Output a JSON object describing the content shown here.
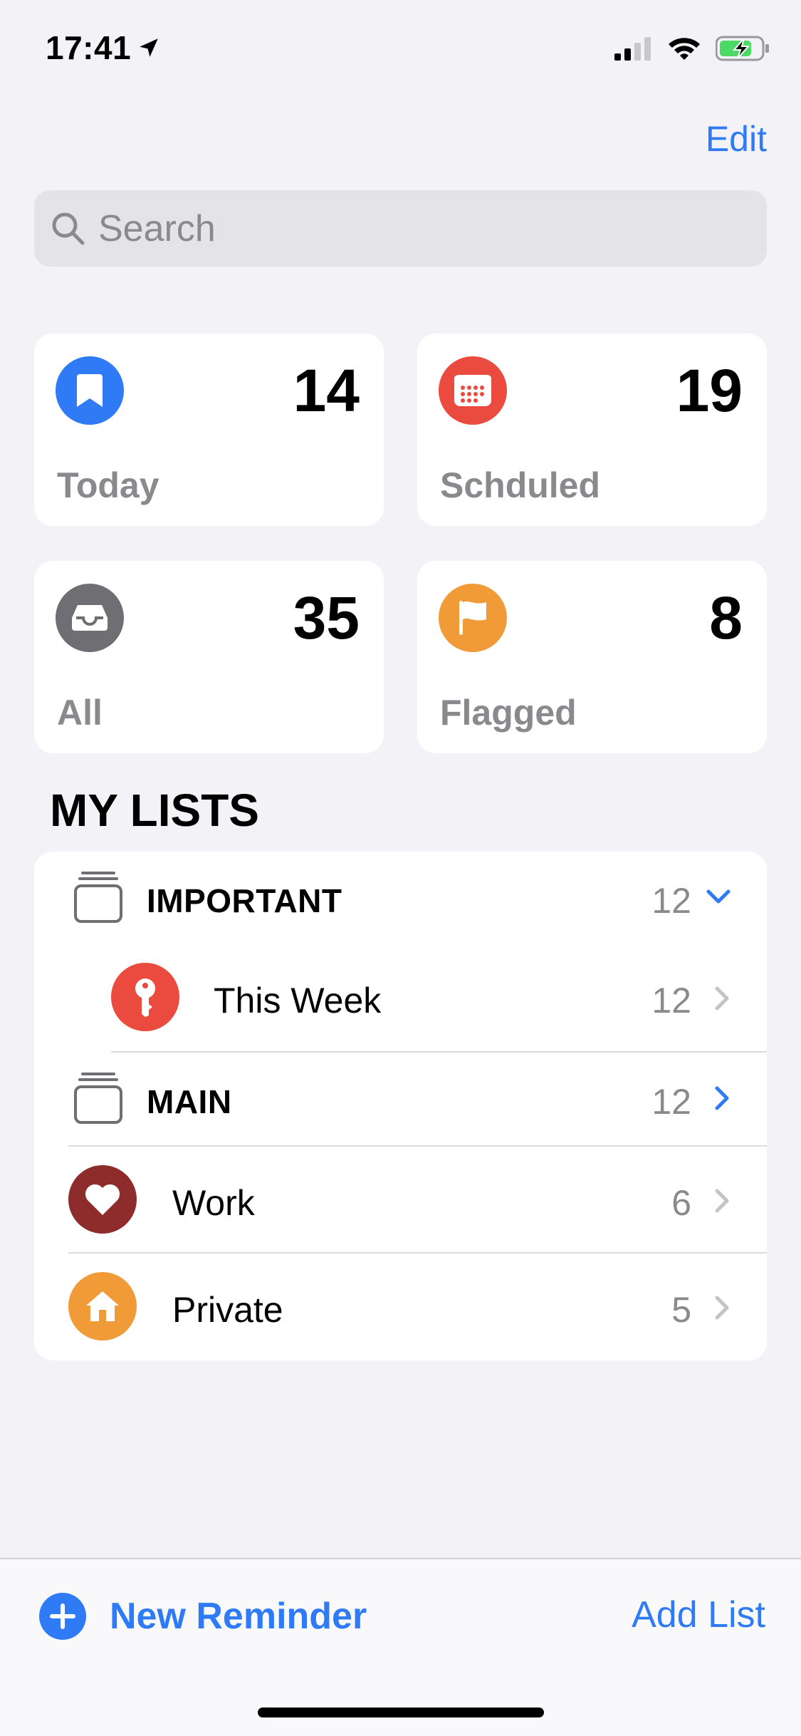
{
  "status_bar": {
    "time": "17:41"
  },
  "header": {
    "edit_label": "Edit"
  },
  "search": {
    "placeholder": "Search"
  },
  "smart_lists": [
    {
      "label": "Today",
      "count": "14",
      "color": "#2F7BF5",
      "icon": "bookmark-icon"
    },
    {
      "label": "Schduled",
      "count": "19",
      "color": "#EA4B3E",
      "icon": "calendar-icon"
    },
    {
      "label": "All",
      "count": "35",
      "color": "#6E6E73",
      "icon": "tray-icon"
    },
    {
      "label": "Flagged",
      "count": "8",
      "color": "#F19A38",
      "icon": "flag-icon"
    }
  ],
  "my_lists": {
    "title": "MY LISTS",
    "groups": [
      {
        "name": "IMPORTANT",
        "count": "12",
        "expanded": true
      },
      {
        "name": "MAIN",
        "count": "12",
        "expanded": false
      }
    ],
    "items": [
      {
        "name": "This Week",
        "count": "12",
        "color": "#EA4B3E",
        "icon": "key-icon"
      },
      {
        "name": "Work",
        "count": "6",
        "color": "#8E2C2C",
        "icon": "heart-icon"
      },
      {
        "name": "Private",
        "count": "5",
        "color": "#F19A38",
        "icon": "house-icon"
      }
    ]
  },
  "toolbar": {
    "new_reminder": "New Reminder",
    "add_list": "Add List"
  },
  "colors": {
    "accent": "#2F7BF5",
    "background": "#F2F2F7"
  }
}
